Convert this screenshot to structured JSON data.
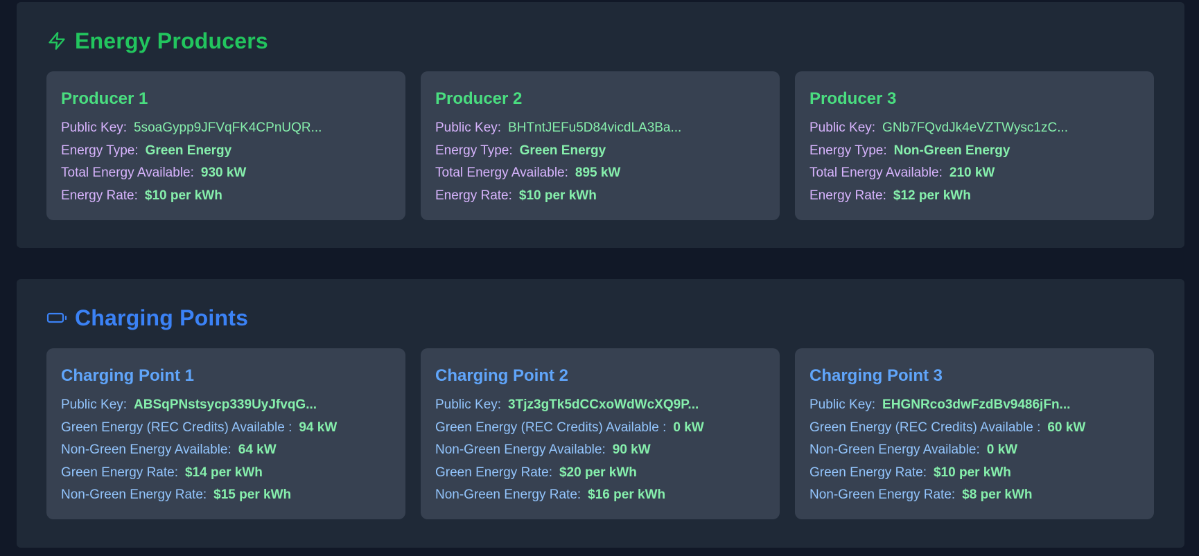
{
  "producers": {
    "title": "Energy Producers",
    "icon": "lightning-bolt-icon",
    "labels": {
      "public_key": "Public Key:",
      "energy_type": "Energy Type:",
      "total_energy": "Total Energy Available:",
      "energy_rate": "Energy Rate:"
    },
    "cards": [
      {
        "title": "Producer 1",
        "public_key": "5soaGypp9JFVqFK4CPnUQR...",
        "energy_type": "Green Energy",
        "total_energy": "930 kW",
        "energy_rate": "$10 per kWh"
      },
      {
        "title": "Producer 2",
        "public_key": "BHTntJEFu5D84vicdLA3Ba...",
        "energy_type": "Green Energy",
        "total_energy": "895 kW",
        "energy_rate": "$10 per kWh"
      },
      {
        "title": "Producer 3",
        "public_key": "GNb7FQvdJk4eVZTWysc1zC...",
        "energy_type": "Non-Green Energy",
        "total_energy": "210 kW",
        "energy_rate": "$12 per kWh"
      }
    ]
  },
  "charging": {
    "title": "Charging Points",
    "icon": "battery-icon",
    "labels": {
      "public_key": "Public Key:",
      "green_available": "Green Energy (REC Credits) Available :",
      "non_green_available": "Non-Green Energy Available:",
      "green_rate": "Green Energy Rate:",
      "non_green_rate": "Non-Green Energy Rate:"
    },
    "cards": [
      {
        "title": "Charging Point 1",
        "public_key": "ABSqPNstsycp339UyJfvqG...",
        "green_available": "94 kW",
        "non_green_available": "64 kW",
        "green_rate": "$14 per kWh",
        "non_green_rate": "$15 per kWh"
      },
      {
        "title": "Charging Point 2",
        "public_key": "3Tjz3gTk5dCCxoWdWcXQ9P...",
        "green_available": "0 kW",
        "non_green_available": "90 kW",
        "green_rate": "$20 per kWh",
        "non_green_rate": "$16 per kWh"
      },
      {
        "title": "Charging Point 3",
        "public_key": "EHGNRco3dwFzdBv9486jFn...",
        "green_available": "60 kW",
        "non_green_available": "0 kW",
        "green_rate": "$10 per kWh",
        "non_green_rate": "$8 per kWh"
      }
    ]
  },
  "colors": {
    "page_bg": "#111827",
    "section_bg": "#1f2937",
    "card_bg": "#374151",
    "producer_accent": "#22c55e",
    "charging_accent": "#3b82f6",
    "value_green": "#86efac"
  }
}
